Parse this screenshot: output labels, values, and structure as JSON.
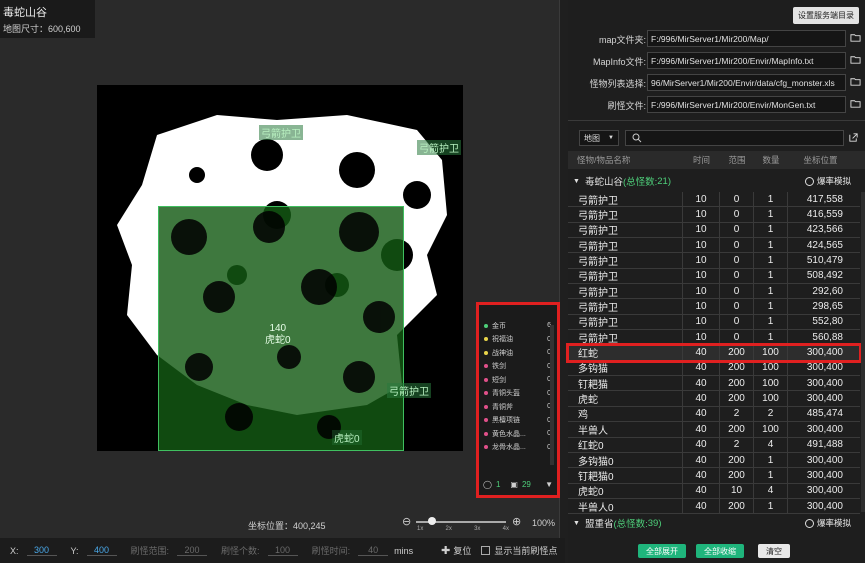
{
  "map": {
    "name": "毒蛇山谷",
    "size_label": "地图尺寸：600,600",
    "spawn_labels": [
      "弓箭护卫",
      "弓箭护卫",
      "弓箭护卫"
    ],
    "center_count": "140",
    "center_name": "虎蛇0",
    "bottom_label": "虎蛇0",
    "coord_label": "坐标位置：400,245",
    "zoom_ticks": [
      "1x",
      "2x",
      "3x",
      "4x"
    ],
    "zoom_percent": "100%"
  },
  "drops": {
    "items": [
      {
        "name": "金币",
        "count": "6",
        "color": "#4ecf7a"
      },
      {
        "name": "祝福油",
        "count": "0",
        "color": "#e8d44a"
      },
      {
        "name": "战神油",
        "count": "0",
        "color": "#e8d44a"
      },
      {
        "name": "铁剑",
        "count": "0",
        "color": "#e0508a"
      },
      {
        "name": "短剑",
        "count": "0",
        "color": "#e0508a"
      },
      {
        "name": "青铜头盔",
        "count": "0",
        "color": "#e0508a"
      },
      {
        "name": "青铜斧",
        "count": "0",
        "color": "#e0508a"
      },
      {
        "name": "黑檀项链",
        "count": "0",
        "color": "#e0508a"
      },
      {
        "name": "黄色水晶...",
        "count": "0",
        "color": "#e0508a"
      },
      {
        "name": "龙骨水晶...",
        "count": "0",
        "color": "#e0508a"
      }
    ],
    "footer_a": "1",
    "footer_b": "29"
  },
  "bottom": {
    "x_label": "X:",
    "x_value": "300",
    "y_label": "Y:",
    "y_value": "400",
    "range_label": "刷怪范围:",
    "range_value": "200",
    "count_label": "刷怪个数:",
    "count_value": "100",
    "time_label": "刷怪时间:",
    "time_value": "40",
    "time_unit": "mins",
    "reset_label": "复位",
    "show_label": "显示当前刷怪点"
  },
  "panel": {
    "settings_button": "设置服务端目录",
    "files": [
      {
        "label": "map文件夹:",
        "value": "F:/996/MirServer1/Mir200/Map/"
      },
      {
        "label": "MapInfo文件:",
        "value": "F:/996/MirServer1/Mir200/Envir/MapInfo.txt"
      },
      {
        "label": "怪物列表选择:",
        "value": "96/MirServer1/Mir200/Envir/data/cfg_monster.xls"
      },
      {
        "label": "刷怪文件:",
        "value": "F:/996/MirServer1/Mir200/Envir/MonGen.txt"
      }
    ],
    "map_select": "地图",
    "columns": {
      "name": "怪物/物品名称",
      "time": "时间",
      "range": "范围",
      "count": "数量",
      "pos": "坐标位置"
    },
    "group1": {
      "title": "毒蛇山谷",
      "sum_prefix": "(总怪数:",
      "sum_value": "21",
      "sum_suffix": ")",
      "burst": "爆率模拟"
    },
    "group2": {
      "title": "盟重省",
      "sum_prefix": "(总怪数:",
      "sum_value": "39",
      "sum_suffix": ")",
      "burst": "爆率模拟"
    },
    "rows": [
      [
        "弓箭护卫",
        "10",
        "0",
        "1",
        "417,558"
      ],
      [
        "弓箭护卫",
        "10",
        "0",
        "1",
        "416,559"
      ],
      [
        "弓箭护卫",
        "10",
        "0",
        "1",
        "423,566"
      ],
      [
        "弓箭护卫",
        "10",
        "0",
        "1",
        "424,565"
      ],
      [
        "弓箭护卫",
        "10",
        "0",
        "1",
        "510,479"
      ],
      [
        "弓箭护卫",
        "10",
        "0",
        "1",
        "508,492"
      ],
      [
        "弓箭护卫",
        "10",
        "0",
        "1",
        "292,60"
      ],
      [
        "弓箭护卫",
        "10",
        "0",
        "1",
        "298,65"
      ],
      [
        "弓箭护卫",
        "10",
        "0",
        "1",
        "552,80"
      ],
      [
        "弓箭护卫",
        "10",
        "0",
        "1",
        "560,88"
      ],
      [
        "红蛇",
        "40",
        "200",
        "100",
        "300,400"
      ],
      [
        "多钩猫",
        "40",
        "200",
        "100",
        "300,400"
      ],
      [
        "钉耙猫",
        "40",
        "200",
        "100",
        "300,400"
      ],
      [
        "虎蛇",
        "40",
        "200",
        "100",
        "300,400"
      ],
      [
        "鸡",
        "40",
        "2",
        "2",
        "485,474"
      ],
      [
        "半兽人",
        "40",
        "200",
        "100",
        "300,400"
      ],
      [
        "红蛇0",
        "40",
        "2",
        "4",
        "491,488"
      ],
      [
        "多钩猫0",
        "40",
        "200",
        "1",
        "300,400"
      ],
      [
        "钉耙猫0",
        "40",
        "200",
        "1",
        "300,400"
      ],
      [
        "虎蛇0",
        "40",
        "10",
        "4",
        "300,400"
      ],
      [
        "半兽人0",
        "40",
        "200",
        "1",
        "300,400"
      ]
    ],
    "selected_row": 10,
    "btn_expand": "全部展开",
    "btn_collapse": "全部收缩",
    "btn_clear": "清空"
  }
}
